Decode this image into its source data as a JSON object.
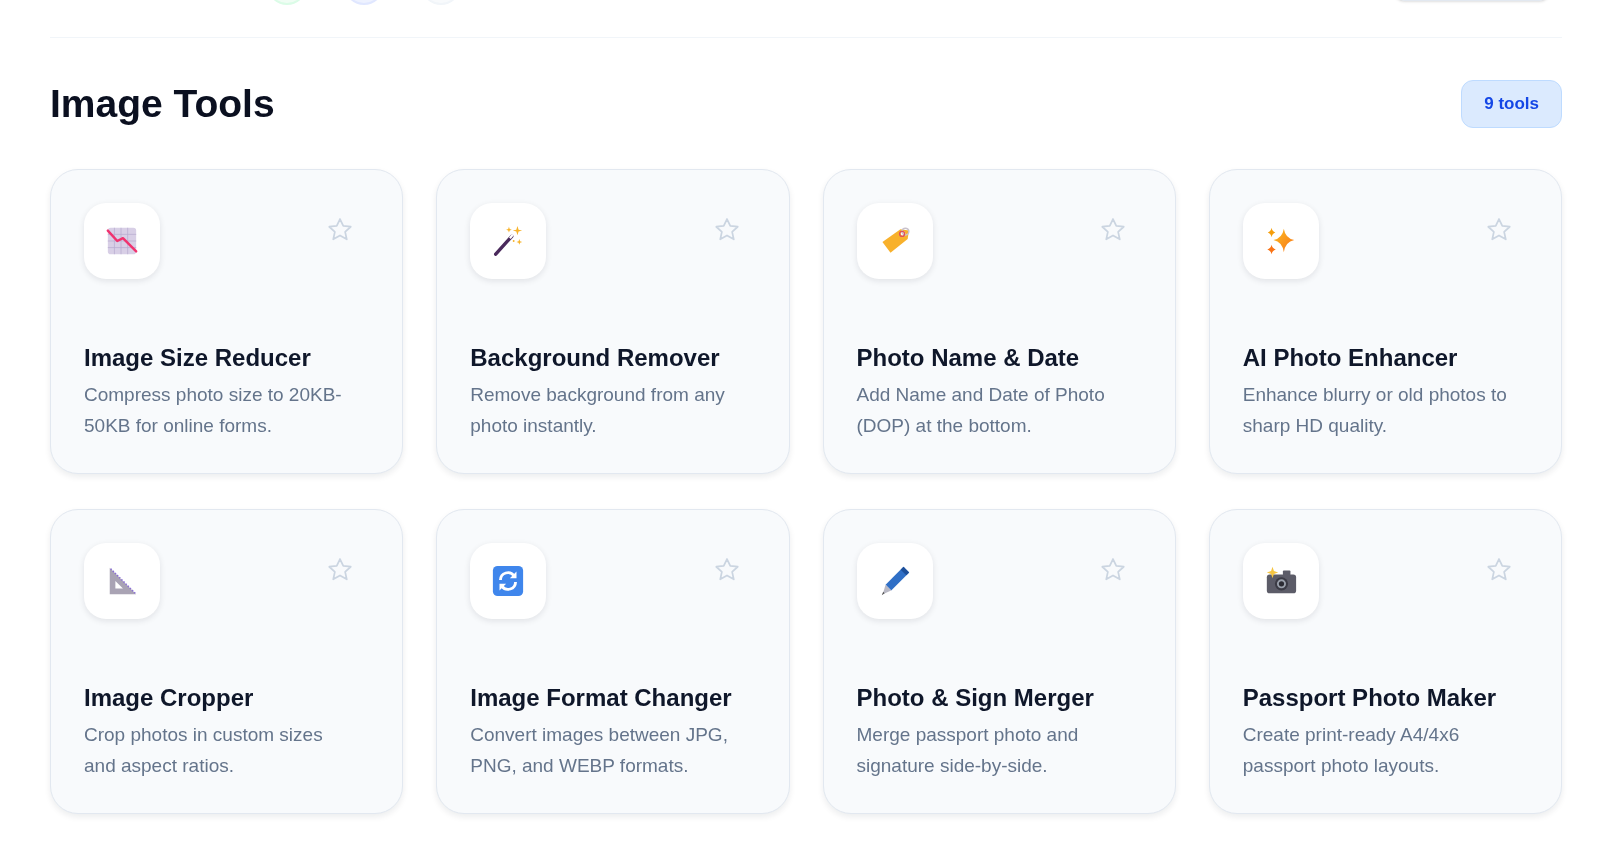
{
  "section": {
    "title": "Image Tools",
    "badge": "9 tools"
  },
  "tools": [
    {
      "title": "Image Size Reducer",
      "description": "Compress photo size to 20KB-50KB for online forms.",
      "favorite": false
    },
    {
      "title": "Background Remover",
      "description": "Remove background from any photo instantly.",
      "favorite": false
    },
    {
      "title": "Photo Name & Date",
      "description": "Add Name and Date of Photo (DOP) at the bottom.",
      "favorite": false
    },
    {
      "title": "AI Photo Enhancer",
      "description": "Enhance blurry or old photos to sharp HD quality.",
      "favorite": false
    },
    {
      "title": "Image Cropper",
      "description": "Crop photos in custom sizes and aspect ratios.",
      "favorite": false
    },
    {
      "title": "Image Format Changer",
      "description": "Convert images between JPG, PNG, and WEBP formats.",
      "favorite": false
    },
    {
      "title": "Photo & Sign Merger",
      "description": "Merge passport photo and signature side-by-side.",
      "favorite": false
    },
    {
      "title": "Passport Photo Maker",
      "description": "Create print-ready A4/4x6 passport photo layouts.",
      "favorite": false
    }
  ]
}
